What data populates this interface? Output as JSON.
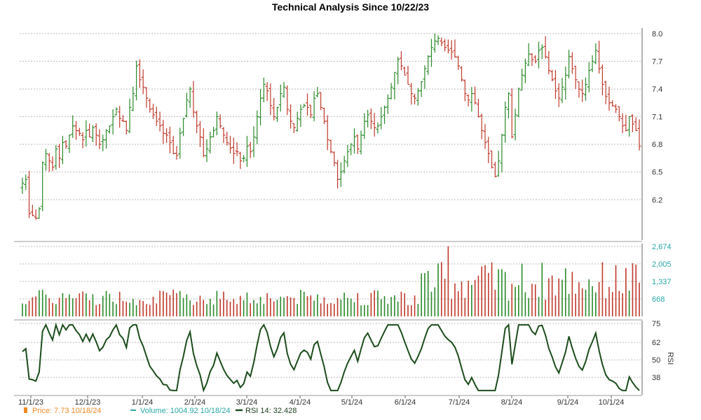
{
  "title": "Technical Analysis Since 10/22/23",
  "colors": {
    "up": "#2a8a2a",
    "down": "#c0392b",
    "rsi": "#1c4d1c",
    "volume_axis": "#2aa7a7",
    "price_legend": "#f08a24",
    "grid": "#bbbbbb"
  },
  "chart_data": [
    {
      "type": "ohlc",
      "name": "Price",
      "x_ticks": [
        "11/1/23",
        "12/1/23",
        "1/1/24",
        "2/1/24",
        "3/1/24",
        "4/1/24",
        "5/1/24",
        "6/1/24",
        "7/1/24",
        "8/1/24",
        "9/1/24",
        "10/1/24"
      ],
      "y_ticks": [
        "8.0",
        "7.7",
        "7.4",
        "7.1",
        "6.8",
        "6.5",
        "6.2"
      ],
      "ylim": [
        5.8,
        8.0
      ],
      "grid": true,
      "closes": [
        6.38,
        6.42,
        6.05,
        6.03,
        6.0,
        6.1,
        6.6,
        6.7,
        6.62,
        6.55,
        6.75,
        6.65,
        6.82,
        6.78,
        6.9,
        7.0,
        6.95,
        6.92,
        6.85,
        6.95,
        6.88,
        6.98,
        6.9,
        6.8,
        6.85,
        6.95,
        7.0,
        7.1,
        7.18,
        7.08,
        7.05,
        6.95,
        7.2,
        7.35,
        7.65,
        7.5,
        7.42,
        7.3,
        7.18,
        7.12,
        7.05,
        7.0,
        6.92,
        6.9,
        6.82,
        6.7,
        6.68,
        6.92,
        7.08,
        7.28,
        7.4,
        7.15,
        7.0,
        6.88,
        6.68,
        6.75,
        6.88,
        6.95,
        7.1,
        7.0,
        6.9,
        6.82,
        6.76,
        6.7,
        6.72,
        6.62,
        6.65,
        6.78,
        6.72,
        6.88,
        7.1,
        7.3,
        7.45,
        7.38,
        7.22,
        7.1,
        7.2,
        7.35,
        7.42,
        7.18,
        7.05,
        6.98,
        7.08,
        7.18,
        7.22,
        7.2,
        7.12,
        7.3,
        7.35,
        7.2,
        7.05,
        6.85,
        6.72,
        6.6,
        6.42,
        6.5,
        6.62,
        6.72,
        6.8,
        6.88,
        6.75,
        6.9,
        7.05,
        7.12,
        7.05,
        6.98,
        7.0,
        7.1,
        7.2,
        7.3,
        7.42,
        7.58,
        7.72,
        7.65,
        7.55,
        7.45,
        7.35,
        7.3,
        7.38,
        7.48,
        7.62,
        7.75,
        7.85,
        7.92,
        7.95,
        7.9,
        7.85,
        7.82,
        7.8,
        7.75,
        7.65,
        7.5,
        7.35,
        7.28,
        7.35,
        7.25,
        7.1,
        6.95,
        6.82,
        6.7,
        6.55,
        6.45,
        6.62,
        6.9,
        7.2,
        7.35,
        6.88,
        7.12,
        7.4,
        7.55,
        7.68,
        7.78,
        7.72,
        7.7,
        7.82,
        7.85,
        7.75,
        7.6,
        7.5,
        7.38,
        7.3,
        7.42,
        7.55,
        7.75,
        7.62,
        7.5,
        7.4,
        7.35,
        7.45,
        7.6,
        7.7,
        7.82,
        7.62,
        7.45,
        7.32,
        7.25,
        7.22,
        7.18,
        7.1,
        7.0,
        6.95,
        7.1,
        7.02,
        6.95,
        6.78
      ]
    },
    {
      "type": "bar",
      "name": "Volume",
      "y_ticks": [
        "2,674",
        "2,005",
        "1,337",
        "668"
      ],
      "ylim": [
        0,
        2674
      ],
      "max_value": 2674
    },
    {
      "type": "line",
      "name": "RSI 14",
      "y_label": "RSI",
      "y_ticks": [
        "75",
        "62",
        "50",
        "38"
      ],
      "ylim": [
        28,
        75
      ]
    }
  ],
  "legend": {
    "price": "Price: 7.73  10/18/24",
    "volume": "Volume: 1004.92  10/18/24",
    "rsi": "RSI 14: 32.428"
  }
}
